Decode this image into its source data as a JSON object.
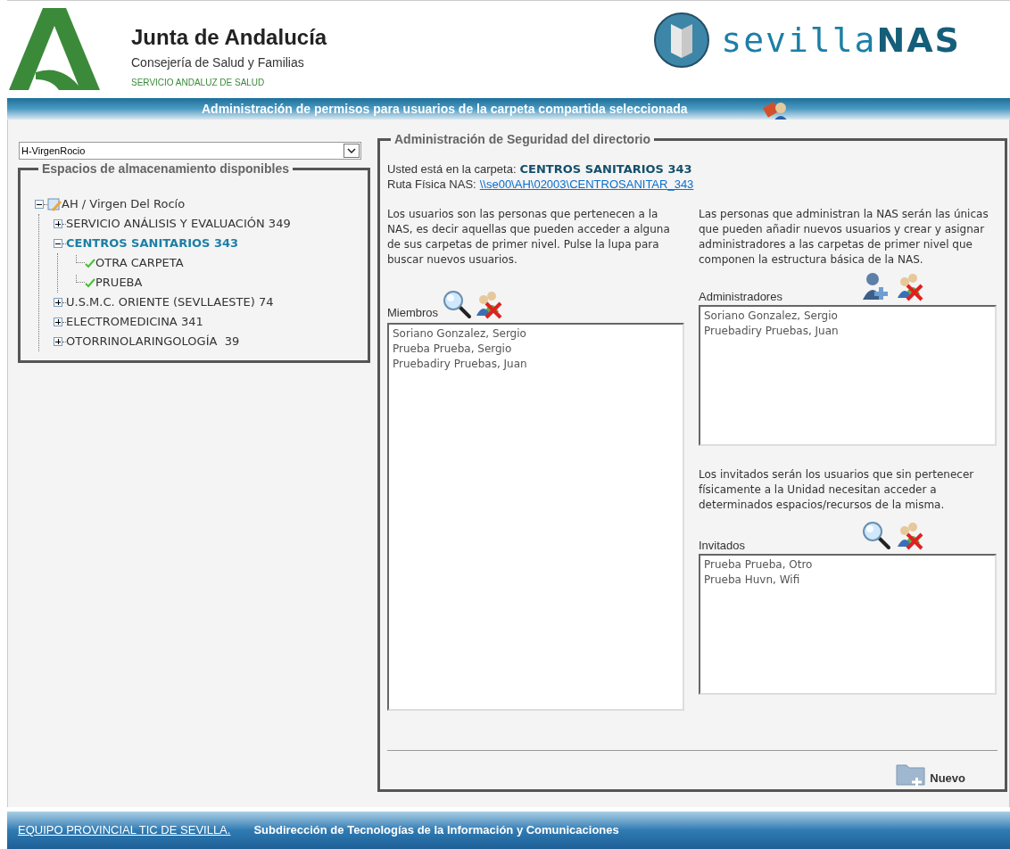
{
  "header": {
    "org_name": "Junta de Andalucía",
    "org_department": "Consejería de Salud y Familias",
    "org_service": "SERVICIO ANDALUZ DE SALUD",
    "brand_prefix": "sevilla",
    "brand_suffix": "NAS"
  },
  "title_bar": {
    "title": "Administración de permisos para usuarios de la carpeta compartida seleccionada"
  },
  "sidebar": {
    "dropdown": {
      "value": "H-VirgenRocio"
    },
    "legend": "Espacios de almacenamiento disponibles",
    "tree": [
      {
        "kind": "root",
        "label": "AH / Virgen Del Rocío",
        "expanded": true,
        "selected": false,
        "children": [
          {
            "kind": "folder",
            "label": "SERVICIO ANÁLISIS Y EVALUACIÓN 349",
            "expanded": false,
            "selected": false
          },
          {
            "kind": "folder",
            "label": "CENTROS SANITARIOS 343",
            "expanded": true,
            "selected": true,
            "children": [
              {
                "kind": "leaf",
                "label": "OTRA CARPETA",
                "selected": false
              },
              {
                "kind": "leaf",
                "label": "PRUEBA",
                "selected": false
              }
            ]
          },
          {
            "kind": "folder",
            "label": "U.S.M.C. ORIENTE (SEVLLAESTE) 74",
            "expanded": false,
            "selected": false
          },
          {
            "kind": "folder",
            "label": "ELECTROMEDICINA 341",
            "expanded": false,
            "selected": false
          },
          {
            "kind": "folder",
            "label": "OTORRINOLARINGOLOGÍA  39",
            "expanded": false,
            "selected": false
          }
        ]
      }
    ]
  },
  "main": {
    "legend": "Administración de Seguridad del directorio",
    "folder_label": "Usted está en la carpeta:",
    "folder_name": "CENTROS SANITARIOS 343",
    "path_label": "Ruta Física NAS:",
    "path_link": "\\\\se00\\AH\\02003\\CENTROSANITAR_343",
    "members_help": "Los usuarios son las personas que pertenecen a la NAS, es decir aquellas que pueden acceder a alguna de sus carpetas de primer nivel.  Pulse la lupa para buscar nuevos usuarios.",
    "members": {
      "label": "Miembros",
      "items": [
        "Soriano Gonzalez, Sergio",
        "Prueba Prueba, Sergio",
        "Pruebadiry Pruebas, Juan"
      ]
    },
    "admins_help": "Las personas que administran la NAS serán las únicas que pueden añadir nuevos usuarios y crear y asignar administradores a las carpetas de primer nivel que componen la estructura básica de la NAS.",
    "admins": {
      "label": "Administradores",
      "items": [
        "Soriano Gonzalez, Sergio",
        "Pruebadiry Pruebas, Juan"
      ]
    },
    "guests_help": "Los invitados serán los usuarios que sin pertenecer físicamente a la Unidad necesitan acceder a determinados espacios/recursos de la misma.",
    "guests": {
      "label": "Invitados",
      "items": [
        "Prueba Prueba, Otro",
        "Prueba Huvn, Wifi"
      ]
    },
    "new_button": "Nuevo"
  },
  "footer": {
    "link": "EQUIPO PROVINCIAL TIC DE SEVILLA.",
    "text": "Subdirección de Tecnologías de la Información y Comunicaciones"
  }
}
